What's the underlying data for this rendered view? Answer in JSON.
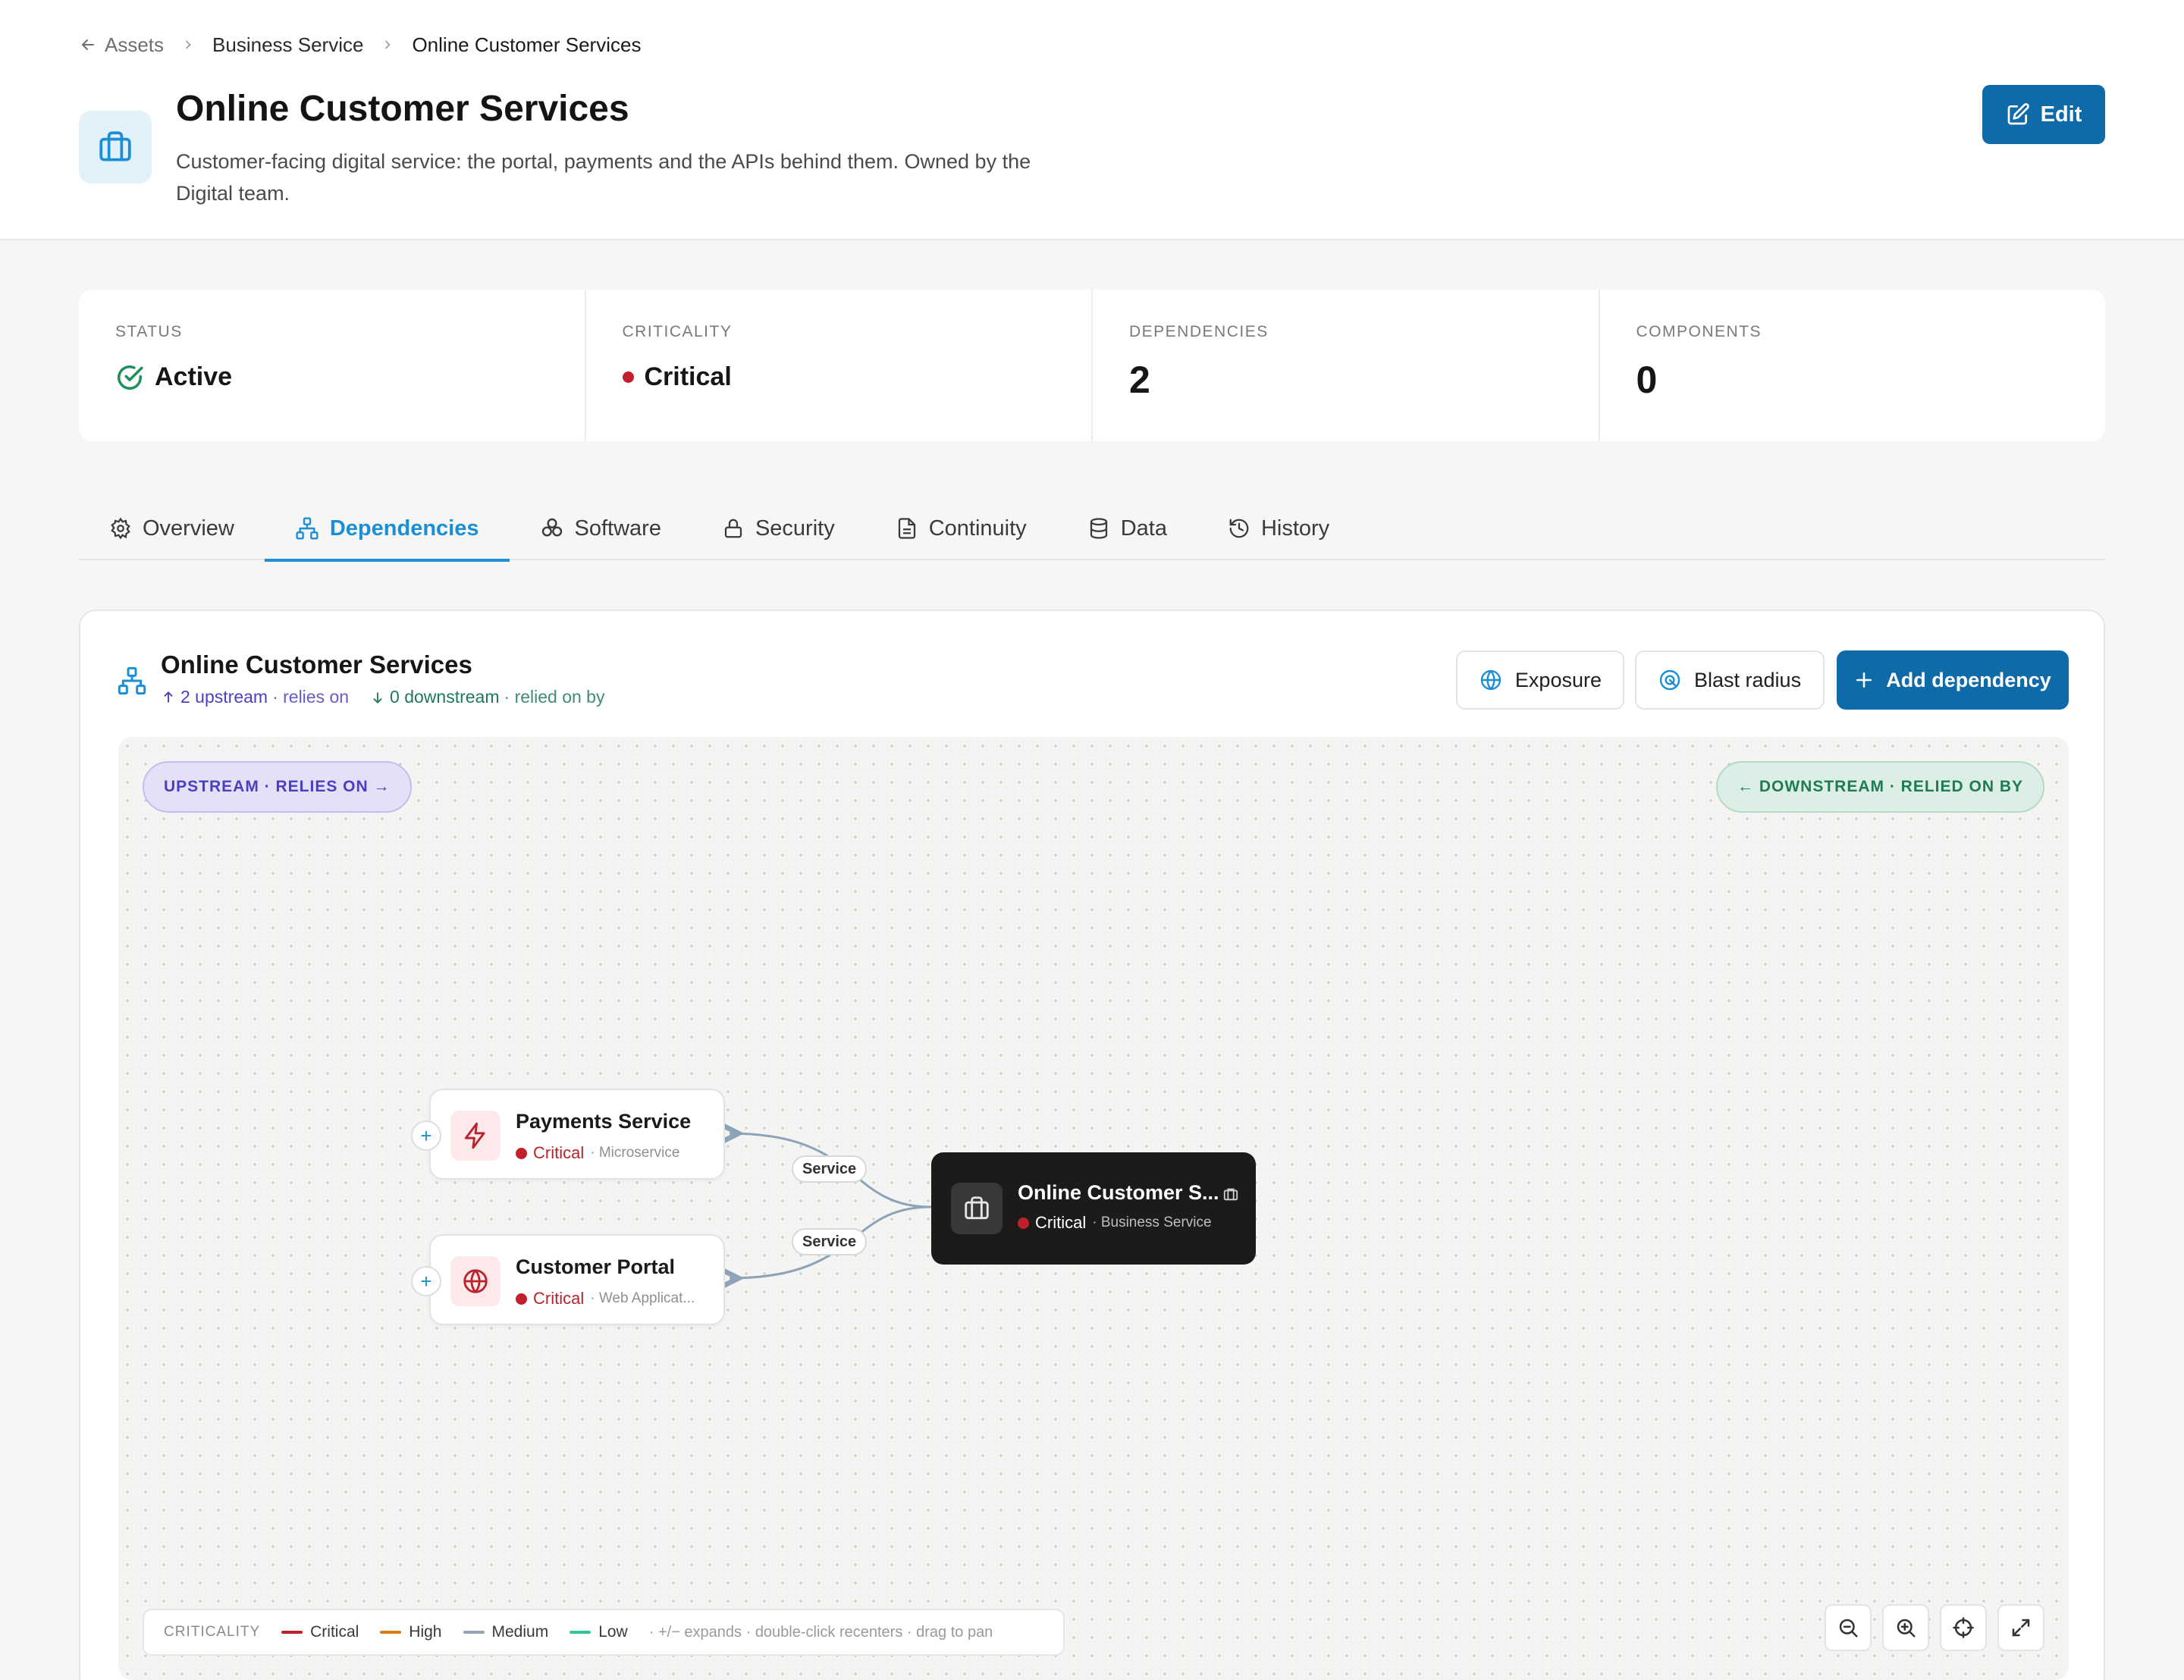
{
  "breadcrumb": {
    "back": "Assets",
    "parent": "Business Service",
    "current": "Online Customer Services"
  },
  "header": {
    "title": "Online Customer Services",
    "description": "Customer-facing digital service: the portal, payments and the APIs behind them. Owned by the Digital team.",
    "edit_label": "Edit"
  },
  "stats": {
    "status": {
      "label": "STATUS",
      "value": "Active"
    },
    "criticality": {
      "label": "CRITICALITY",
      "value": "Critical"
    },
    "dependencies": {
      "label": "DEPENDENCIES",
      "value": "2"
    },
    "components": {
      "label": "COMPONENTS",
      "value": "0"
    }
  },
  "tabs": [
    {
      "label": "Overview",
      "icon": "gear-icon"
    },
    {
      "label": "Dependencies",
      "icon": "network-icon",
      "active": true
    },
    {
      "label": "Software",
      "icon": "boxes-icon"
    },
    {
      "label": "Security",
      "icon": "lock-icon"
    },
    {
      "label": "Continuity",
      "icon": "document-icon"
    },
    {
      "label": "Data",
      "icon": "database-icon"
    },
    {
      "label": "History",
      "icon": "history-icon"
    }
  ],
  "panel": {
    "title": "Online Customer Services",
    "upstream_count": "2 upstream",
    "upstream_text": "· relies on",
    "downstream_count": "0 downstream",
    "downstream_text": "· relied on by",
    "exposure_label": "Exposure",
    "blast_label": "Blast radius",
    "add_label": "Add dependency"
  },
  "graph": {
    "upstream_pill": "UPSTREAM · RELIES ON →",
    "downstream_pill": "← DOWNSTREAM · RELIED ON BY",
    "nodes": [
      {
        "name": "Payments Service",
        "criticality": "Critical",
        "type": "· Microservice",
        "icon": "lightning-icon"
      },
      {
        "name": "Customer Portal",
        "criticality": "Critical",
        "type": "· Web Applicat...",
        "icon": "globe-icon"
      }
    ],
    "center": {
      "name": "Online Customer S...",
      "criticality": "Critical",
      "type": "· Business Service",
      "icon": "briefcase-icon"
    },
    "edges": [
      {
        "label": "Service"
      },
      {
        "label": "Service"
      }
    ]
  },
  "legend": {
    "title": "CRITICALITY",
    "items": [
      {
        "label": "Critical",
        "color": "#c0202a"
      },
      {
        "label": "High",
        "color": "#d97a16"
      },
      {
        "label": "Medium",
        "color": "#94a3b8"
      },
      {
        "label": "Low",
        "color": "#2fc79a"
      }
    ],
    "hint": "· +/− expands · double-click recenters · drag to pan"
  },
  "colors": {
    "accent": "#0f6aa8",
    "link": "#1a8fd6",
    "critical": "#c0202a",
    "dark_node": "#1d1b1a"
  }
}
